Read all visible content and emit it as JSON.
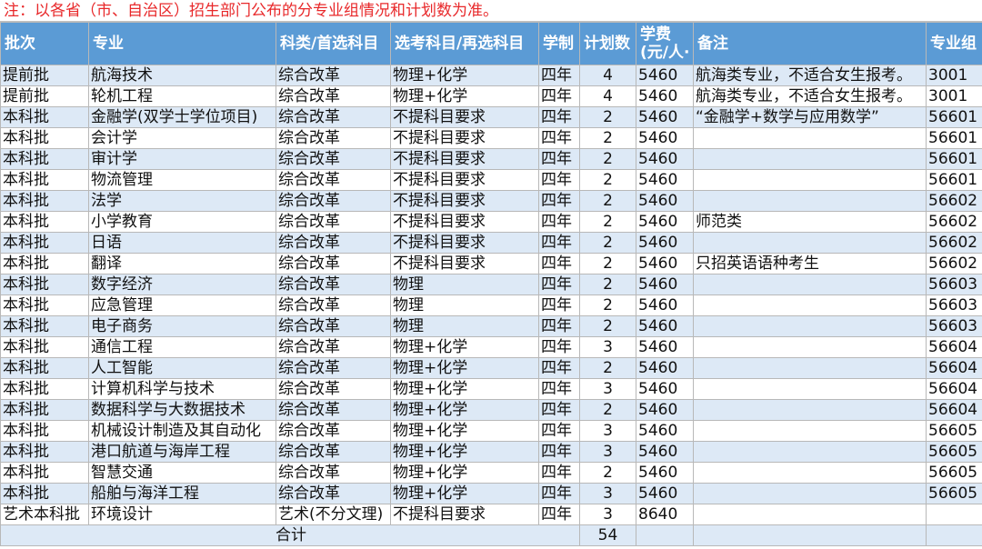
{
  "note": "注：以各省（市、自治区）招生部门公布的分专业组情况和计划数为准。",
  "headers": {
    "batch": "批次",
    "major": "专业",
    "category": "科类/首选科目",
    "elective": "选考科目/再选科目",
    "years": "学制",
    "plan": "计划数",
    "fee_line1": "学费",
    "fee_line2": "(元/人·",
    "remark": "备注",
    "group": "专业组"
  },
  "rows": [
    {
      "batch": "提前批",
      "major": "航海技术",
      "category": "综合改革",
      "elective": "物理+化学",
      "years": "四年",
      "plan": "4",
      "fee": "5460",
      "remark": "航海类专业，不适合女生报考。",
      "group": "3001"
    },
    {
      "batch": "提前批",
      "major": "轮机工程",
      "category": "综合改革",
      "elective": "物理+化学",
      "years": "四年",
      "plan": "4",
      "fee": "5460",
      "remark": "航海类专业，不适合女生报考。",
      "group": "3001"
    },
    {
      "batch": "本科批",
      "major": "金融学(双学士学位项目)",
      "category": "综合改革",
      "elective": "不提科目要求",
      "years": "四年",
      "plan": "2",
      "fee": "5460",
      "remark": "“金融学+数学与应用数学”",
      "group": "56601"
    },
    {
      "batch": "本科批",
      "major": "会计学",
      "category": "综合改革",
      "elective": "不提科目要求",
      "years": "四年",
      "plan": "2",
      "fee": "5460",
      "remark": "",
      "group": "56601"
    },
    {
      "batch": "本科批",
      "major": "审计学",
      "category": "综合改革",
      "elective": "不提科目要求",
      "years": "四年",
      "plan": "2",
      "fee": "5460",
      "remark": "",
      "group": "56601"
    },
    {
      "batch": "本科批",
      "major": "物流管理",
      "category": "综合改革",
      "elective": "不提科目要求",
      "years": "四年",
      "plan": "2",
      "fee": "5460",
      "remark": "",
      "group": "56601"
    },
    {
      "batch": "本科批",
      "major": "法学",
      "category": "综合改革",
      "elective": "不提科目要求",
      "years": "四年",
      "plan": "2",
      "fee": "5460",
      "remark": "",
      "group": "56602"
    },
    {
      "batch": "本科批",
      "major": "小学教育",
      "category": "综合改革",
      "elective": "不提科目要求",
      "years": "四年",
      "plan": "2",
      "fee": "5460",
      "remark": "师范类",
      "group": "56602"
    },
    {
      "batch": "本科批",
      "major": "日语",
      "category": "综合改革",
      "elective": "不提科目要求",
      "years": "四年",
      "plan": "2",
      "fee": "5460",
      "remark": "",
      "group": "56602"
    },
    {
      "batch": "本科批",
      "major": "翻译",
      "category": "综合改革",
      "elective": "不提科目要求",
      "years": "四年",
      "plan": "2",
      "fee": "5460",
      "remark": "只招英语语种考生",
      "group": "56602"
    },
    {
      "batch": "本科批",
      "major": "数字经济",
      "category": "综合改革",
      "elective": "物理",
      "years": "四年",
      "plan": "2",
      "fee": "5460",
      "remark": "",
      "group": "56603"
    },
    {
      "batch": "本科批",
      "major": "应急管理",
      "category": "综合改革",
      "elective": "物理",
      "years": "四年",
      "plan": "2",
      "fee": "5460",
      "remark": "",
      "group": "56603"
    },
    {
      "batch": "本科批",
      "major": "电子商务",
      "category": "综合改革",
      "elective": "物理",
      "years": "四年",
      "plan": "2",
      "fee": "5460",
      "remark": "",
      "group": "56603"
    },
    {
      "batch": "本科批",
      "major": "通信工程",
      "category": "综合改革",
      "elective": "物理+化学",
      "years": "四年",
      "plan": "3",
      "fee": "5460",
      "remark": "",
      "group": "56604"
    },
    {
      "batch": "本科批",
      "major": "人工智能",
      "category": "综合改革",
      "elective": "物理+化学",
      "years": "四年",
      "plan": "2",
      "fee": "5460",
      "remark": "",
      "group": "56604"
    },
    {
      "batch": "本科批",
      "major": "计算机科学与技术",
      "category": "综合改革",
      "elective": "物理+化学",
      "years": "四年",
      "plan": "3",
      "fee": "5460",
      "remark": "",
      "group": "56604"
    },
    {
      "batch": "本科批",
      "major": "数据科学与大数据技术",
      "category": "综合改革",
      "elective": "物理+化学",
      "years": "四年",
      "plan": "2",
      "fee": "5460",
      "remark": "",
      "group": "56604"
    },
    {
      "batch": "本科批",
      "major": "机械设计制造及其自动化",
      "category": "综合改革",
      "elective": "物理+化学",
      "years": "四年",
      "plan": "3",
      "fee": "5460",
      "remark": "",
      "group": "56605"
    },
    {
      "batch": "本科批",
      "major": "港口航道与海岸工程",
      "category": "综合改革",
      "elective": "物理+化学",
      "years": "四年",
      "plan": "3",
      "fee": "5460",
      "remark": "",
      "group": "56605"
    },
    {
      "batch": "本科批",
      "major": "智慧交通",
      "category": "综合改革",
      "elective": "物理+化学",
      "years": "四年",
      "plan": "2",
      "fee": "5460",
      "remark": "",
      "group": "56605"
    },
    {
      "batch": "本科批",
      "major": "船舶与海洋工程",
      "category": "综合改革",
      "elective": "物理+化学",
      "years": "四年",
      "plan": "3",
      "fee": "5460",
      "remark": "",
      "group": "56605"
    },
    {
      "batch": "艺术本科批",
      "major": "环境设计",
      "category": "艺术(不分文理)",
      "elective": "不提科目要求",
      "years": "四年",
      "plan": "3",
      "fee": "8640",
      "remark": "",
      "group": ""
    }
  ],
  "total": {
    "label": "合计",
    "plan": "54"
  }
}
